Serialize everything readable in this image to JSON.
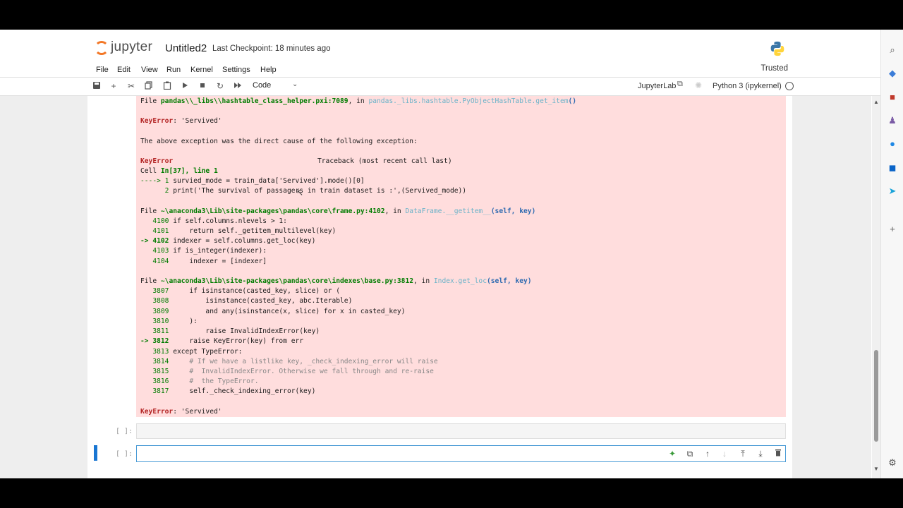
{
  "header": {
    "logo_text": "jupyter",
    "notebook_title": "Untitled2",
    "checkpoint": "Last Checkpoint: 18 minutes ago"
  },
  "menu": {
    "items": [
      "File",
      "Edit",
      "View",
      "Run",
      "Kernel",
      "Settings",
      "Help"
    ],
    "trusted": "Trusted"
  },
  "toolbar": {
    "cell_type": "Code",
    "jupyterlab_link": "JupyterLab",
    "kernel_name": "Python 3 (ipykernel)"
  },
  "error_output": {
    "l0_prefix": "File ",
    "l0_path": "pandas\\\\_libs\\\\hashtable_class_helper.pxi:7089",
    "l0_in": ", in ",
    "l0_func": "pandas._libs.hashtable.PyObjectHashTable.get_item",
    "l0_paren": "()",
    "l1_err": "KeyError",
    "l1_msg": ": 'Servived'",
    "l2": "The above exception was the direct cause of the following exception:",
    "l3_err": "KeyError",
    "l3_tb": "Traceback (most recent call last)",
    "l4_cell": "Cell ",
    "l4_in": "In[37], line 1",
    "l5_arrow": "----> 1 ",
    "l5_code": "survied_mode = train_data['Servived'].mode()[0]",
    "l6_num": "      2 ",
    "l6_code": "print('The survival of passagers in train dataset is :',(Servived_mode))",
    "l7_prefix": "File ",
    "l7_path": "~\\anaconda3\\Lib\\site-packages\\pandas\\core\\frame.py:4102",
    "l7_in": ", in ",
    "l7_func": "DataFrame.__getitem__",
    "l7_args": "(self, key)",
    "f1": [
      {
        "num": "   4100 ",
        "code": "if self.columns.nlevels > 1:"
      },
      {
        "num": "   4101 ",
        "code": "    return self._getitem_multilevel(key)"
      },
      {
        "num": "-> 4102 ",
        "code": "indexer = self.columns.get_loc(key)"
      },
      {
        "num": "   4103 ",
        "code": "if is_integer(indexer):"
      },
      {
        "num": "   4104 ",
        "code": "    indexer = [indexer]"
      }
    ],
    "l13_prefix": "File ",
    "l13_path": "~\\anaconda3\\Lib\\site-packages\\pandas\\core\\indexes\\base.py:3812",
    "l13_in": ", in ",
    "l13_func": "Index.get_loc",
    "l13_args": "(self, key)",
    "f2": [
      {
        "num": "   3807 ",
        "code": "    if isinstance(casted_key, slice) or ("
      },
      {
        "num": "   3808 ",
        "code": "        isinstance(casted_key, abc.Iterable)"
      },
      {
        "num": "   3809 ",
        "code": "        and any(isinstance(x, slice) for x in casted_key)"
      },
      {
        "num": "   3810 ",
        "code": "    ):"
      },
      {
        "num": "   3811 ",
        "code": "        raise InvalidIndexError(key)"
      },
      {
        "num": "-> 3812 ",
        "code": "    raise KeyError(key) from err"
      },
      {
        "num": "   3813 ",
        "code": "except TypeError:"
      },
      {
        "num": "   3814 ",
        "code": "    # If we have a listlike key, _check_indexing_error will raise"
      },
      {
        "num": "   3815 ",
        "code": "    #  InvalidIndexError. Otherwise we fall through and re-raise"
      },
      {
        "num": "   3816 ",
        "code": "    #  the TypeError."
      },
      {
        "num": "   3817 ",
        "code": "    self._check_indexing_error(key)"
      }
    ],
    "last_err": "KeyError",
    "last_msg": ": 'Servived'"
  },
  "cells": {
    "empty_prompt": "[ ]:",
    "active_prompt": "[ ]:"
  },
  "icons": {
    "toolbar": [
      "save-icon",
      "add-cell-icon",
      "cut-icon",
      "copy-icon",
      "paste-icon",
      "run-icon",
      "stop-icon",
      "restart-icon",
      "fast-forward-icon"
    ],
    "cell_toolbar": [
      "sparkle-icon",
      "duplicate-icon",
      "move-up-icon",
      "move-down-icon",
      "insert-above-icon",
      "insert-below-icon",
      "delete-icon"
    ],
    "edge_bar": [
      "search-icon",
      "tag-icon",
      "briefcase-icon",
      "chess-icon",
      "office-icon",
      "outlook-icon",
      "send-icon",
      "plus-icon",
      "settings-icon"
    ]
  },
  "colors": {
    "error_bg": "#ffdddd",
    "active_cell": "#1976d2",
    "jupyter_orange": "#f37726"
  }
}
